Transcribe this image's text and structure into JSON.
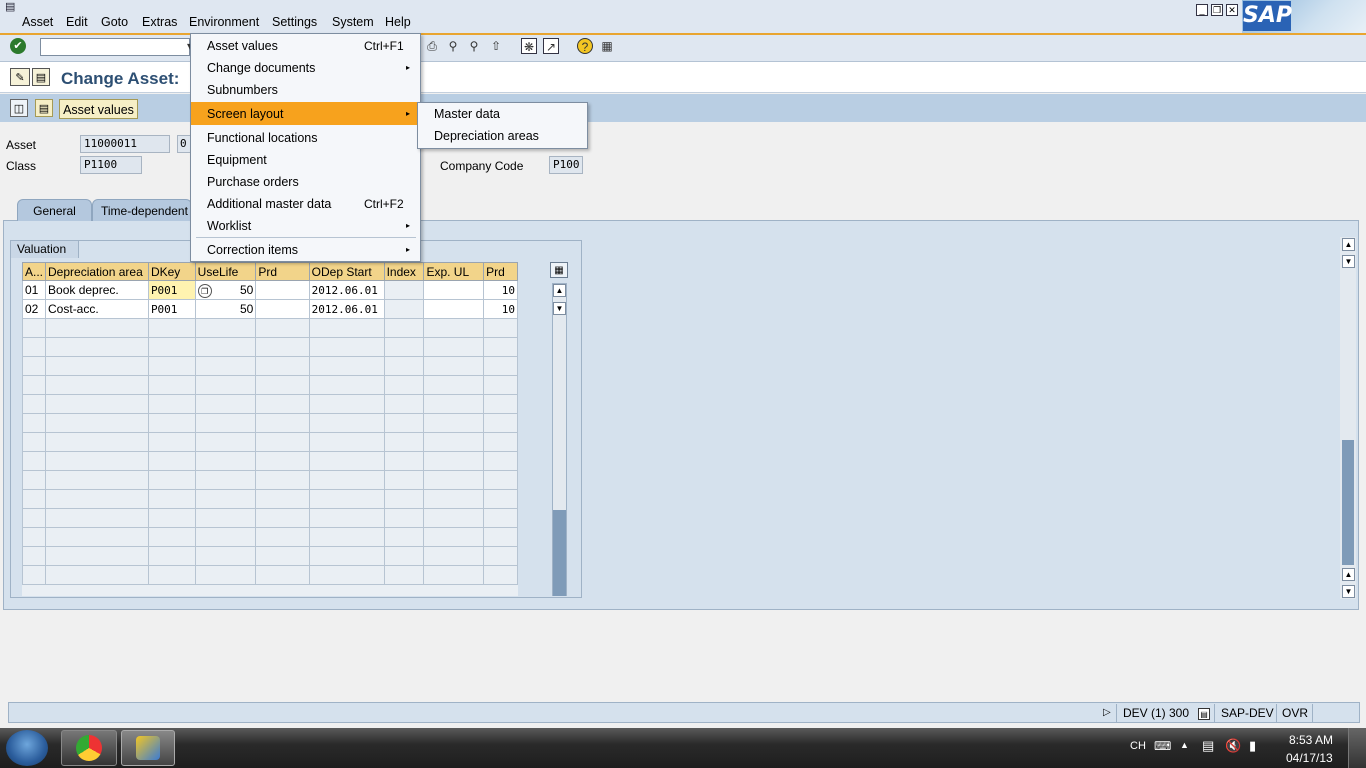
{
  "menubar": {
    "items": [
      "Asset",
      "Edit",
      "Goto",
      "Extras",
      "Environment",
      "Settings",
      "System",
      "Help"
    ]
  },
  "sap_logo": "SAP",
  "title": "Change Asset:",
  "app_toolbar": {
    "asset_values_button": "Asset values"
  },
  "header": {
    "asset_label": "Asset",
    "asset_value": "11000011",
    "asset_sub": "0",
    "class_label": "Class",
    "class_value": "P1100",
    "company_code_label": "Company Code",
    "company_code_value": "P100"
  },
  "tabs": [
    "General",
    "Time-dependent"
  ],
  "valuation": {
    "title": "Valuation",
    "columns": [
      "A...",
      "Depreciation area",
      "DKey",
      "UseLife",
      "Prd",
      "ODep Start",
      "Index",
      "Exp. UL",
      "Prd"
    ],
    "rows": [
      [
        "01",
        "Book deprec.",
        "P001",
        "50",
        "",
        "2012.06.01",
        "",
        "",
        "10"
      ],
      [
        "02",
        "Cost-acc.",
        "P001",
        "50",
        "",
        "2012.06.01",
        "",
        "",
        "10"
      ]
    ]
  },
  "environment_menu": {
    "items": [
      {
        "label": "Asset values",
        "shortcut": "Ctrl+F1",
        "submenu": false
      },
      {
        "label": "Change documents",
        "shortcut": "",
        "submenu": true
      },
      {
        "label": "Subnumbers",
        "shortcut": "",
        "submenu": false
      },
      {
        "label": "Screen layout",
        "shortcut": "",
        "submenu": true,
        "highlighted": true
      },
      {
        "label": "Functional locations",
        "shortcut": "",
        "submenu": false
      },
      {
        "label": "Equipment",
        "shortcut": "",
        "submenu": false
      },
      {
        "label": "Purchase orders",
        "shortcut": "",
        "submenu": false
      },
      {
        "label": "Additional master data",
        "shortcut": "Ctrl+F2",
        "submenu": false
      },
      {
        "label": "Worklist",
        "shortcut": "",
        "submenu": true
      },
      {
        "label": "Correction items",
        "shortcut": "",
        "submenu": true
      }
    ],
    "highlight_color": "#f7a21d"
  },
  "screen_layout_submenu": [
    "Master data",
    "Depreciation areas"
  ],
  "statusbar": {
    "system": "DEV (1) 300",
    "server": "SAP-DEV",
    "mode": "OVR"
  },
  "taskbar": {
    "ime": "CH",
    "time": "8:53 AM",
    "date": "04/17/13"
  },
  "colors": {
    "menubar_bg": "#dfe7f1",
    "accent": "#e9a530",
    "title_text": "#2d4f73",
    "column_header": "#f2d48a"
  }
}
